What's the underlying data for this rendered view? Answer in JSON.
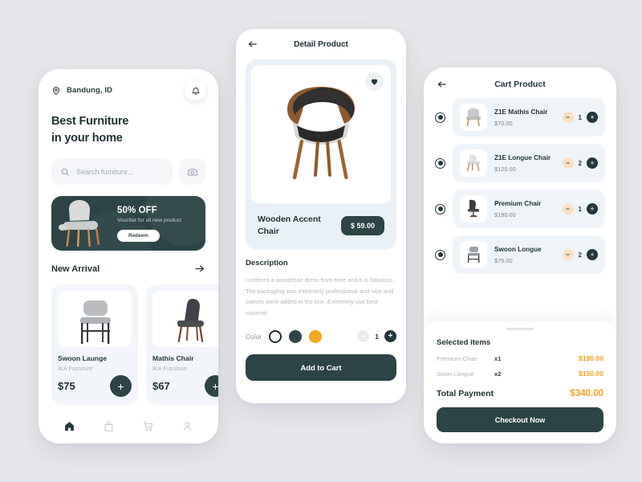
{
  "colors": {
    "background": "#e5e7ea",
    "dark": "#2c4446",
    "accent_orange": "#f2a11e",
    "card_blue": "#eff4f9",
    "minus_peach": "#fbe1c2"
  },
  "home": {
    "location": "Bandung, ID",
    "location_icon": "map-pin-icon",
    "bell_icon": "bell-icon",
    "headline_line1": "Best Furniture",
    "headline_line2": "in your home",
    "search": {
      "placeholder": "Search furniture...",
      "icon": "search-icon"
    },
    "camera_icon": "camera-icon",
    "promo": {
      "title": "50% OFF",
      "subtitle": "Voucher for all new product",
      "button": "Redeem"
    },
    "section": {
      "title": "New Arrival",
      "arrow_icon": "arrow-right-icon"
    },
    "products": [
      {
        "name": "Swoon Launge",
        "brand": "IKA Furniture",
        "price": "$75",
        "add_label": "+"
      },
      {
        "name": "Mathis Chair",
        "brand": "IKA Furniture",
        "price": "$67",
        "add_label": "+"
      }
    ],
    "tabs": [
      {
        "name": "home-icon",
        "active": true
      },
      {
        "name": "bag-icon",
        "active": false
      },
      {
        "name": "cart-icon",
        "active": false
      },
      {
        "name": "profile-icon",
        "active": false
      }
    ]
  },
  "detail": {
    "back_icon": "arrow-left-icon",
    "title": "Detail Product",
    "favorite_icon": "heart-icon",
    "product_name": "Wooden Accent Chair",
    "price": "$ 59.00",
    "description_heading": "Description",
    "description": "I ordered a woodchair dress from here and it is fabulous. The packaging was extremely professional and nice and sweets were added in the box. Extremely use best material",
    "color_label": "Color",
    "swatches": [
      "#ffffff",
      "#2c4446",
      "#f5a623"
    ],
    "quantity": "1",
    "minus_label": "–",
    "plus_label": "+",
    "cta": "Add to Cart"
  },
  "cart": {
    "back_icon": "arrow-left-icon",
    "title": "Cart Product",
    "items": [
      {
        "name": "Z1E Mathis Chair",
        "price": "$70.00",
        "qty": "1"
      },
      {
        "name": "Z1E Longue Chair",
        "price": "$120.00",
        "qty": "2"
      },
      {
        "name": "Premium Chair",
        "price": "$190.00",
        "qty": "1"
      },
      {
        "name": "Swoon Longue",
        "price": "$75.00",
        "qty": "2"
      }
    ],
    "minus_label": "–",
    "plus_label": "+",
    "summary": {
      "heading": "Selected items",
      "lines": [
        {
          "name": "Premium Chair",
          "qty": "x1",
          "amount": "$190.00"
        },
        {
          "name": "Swon Longue",
          "qty": "x2",
          "amount": "$150.00"
        }
      ],
      "total_label": "Total Payment",
      "total_amount": "$340.00",
      "checkout": "Checkout Now"
    }
  }
}
